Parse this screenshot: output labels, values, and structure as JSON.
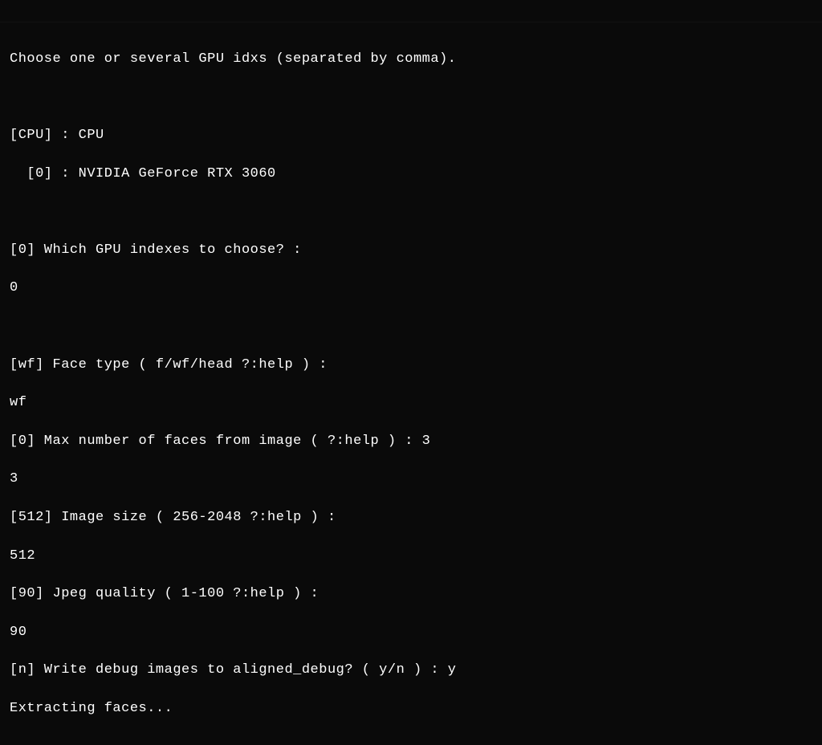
{
  "terminal": {
    "lines": [
      "Choose one or several GPU idxs (separated by comma).",
      "",
      "[CPU] : CPU",
      "  [0] : NVIDIA GeForce RTX 3060",
      "",
      "[0] Which GPU indexes to choose? :",
      "0",
      "",
      "[wf] Face type ( f/wf/head ?:help ) :",
      "wf",
      "[0] Max number of faces from image ( ?:help ) : 3",
      "3",
      "[512] Image size ( 256-2048 ?:help ) :",
      "512",
      "[90] Jpeg quality ( 1-100 ?:help ) :",
      "90",
      "[n] Write debug images to aligned_debug? ( y/n ) : y",
      "Extracting faces..."
    ]
  }
}
